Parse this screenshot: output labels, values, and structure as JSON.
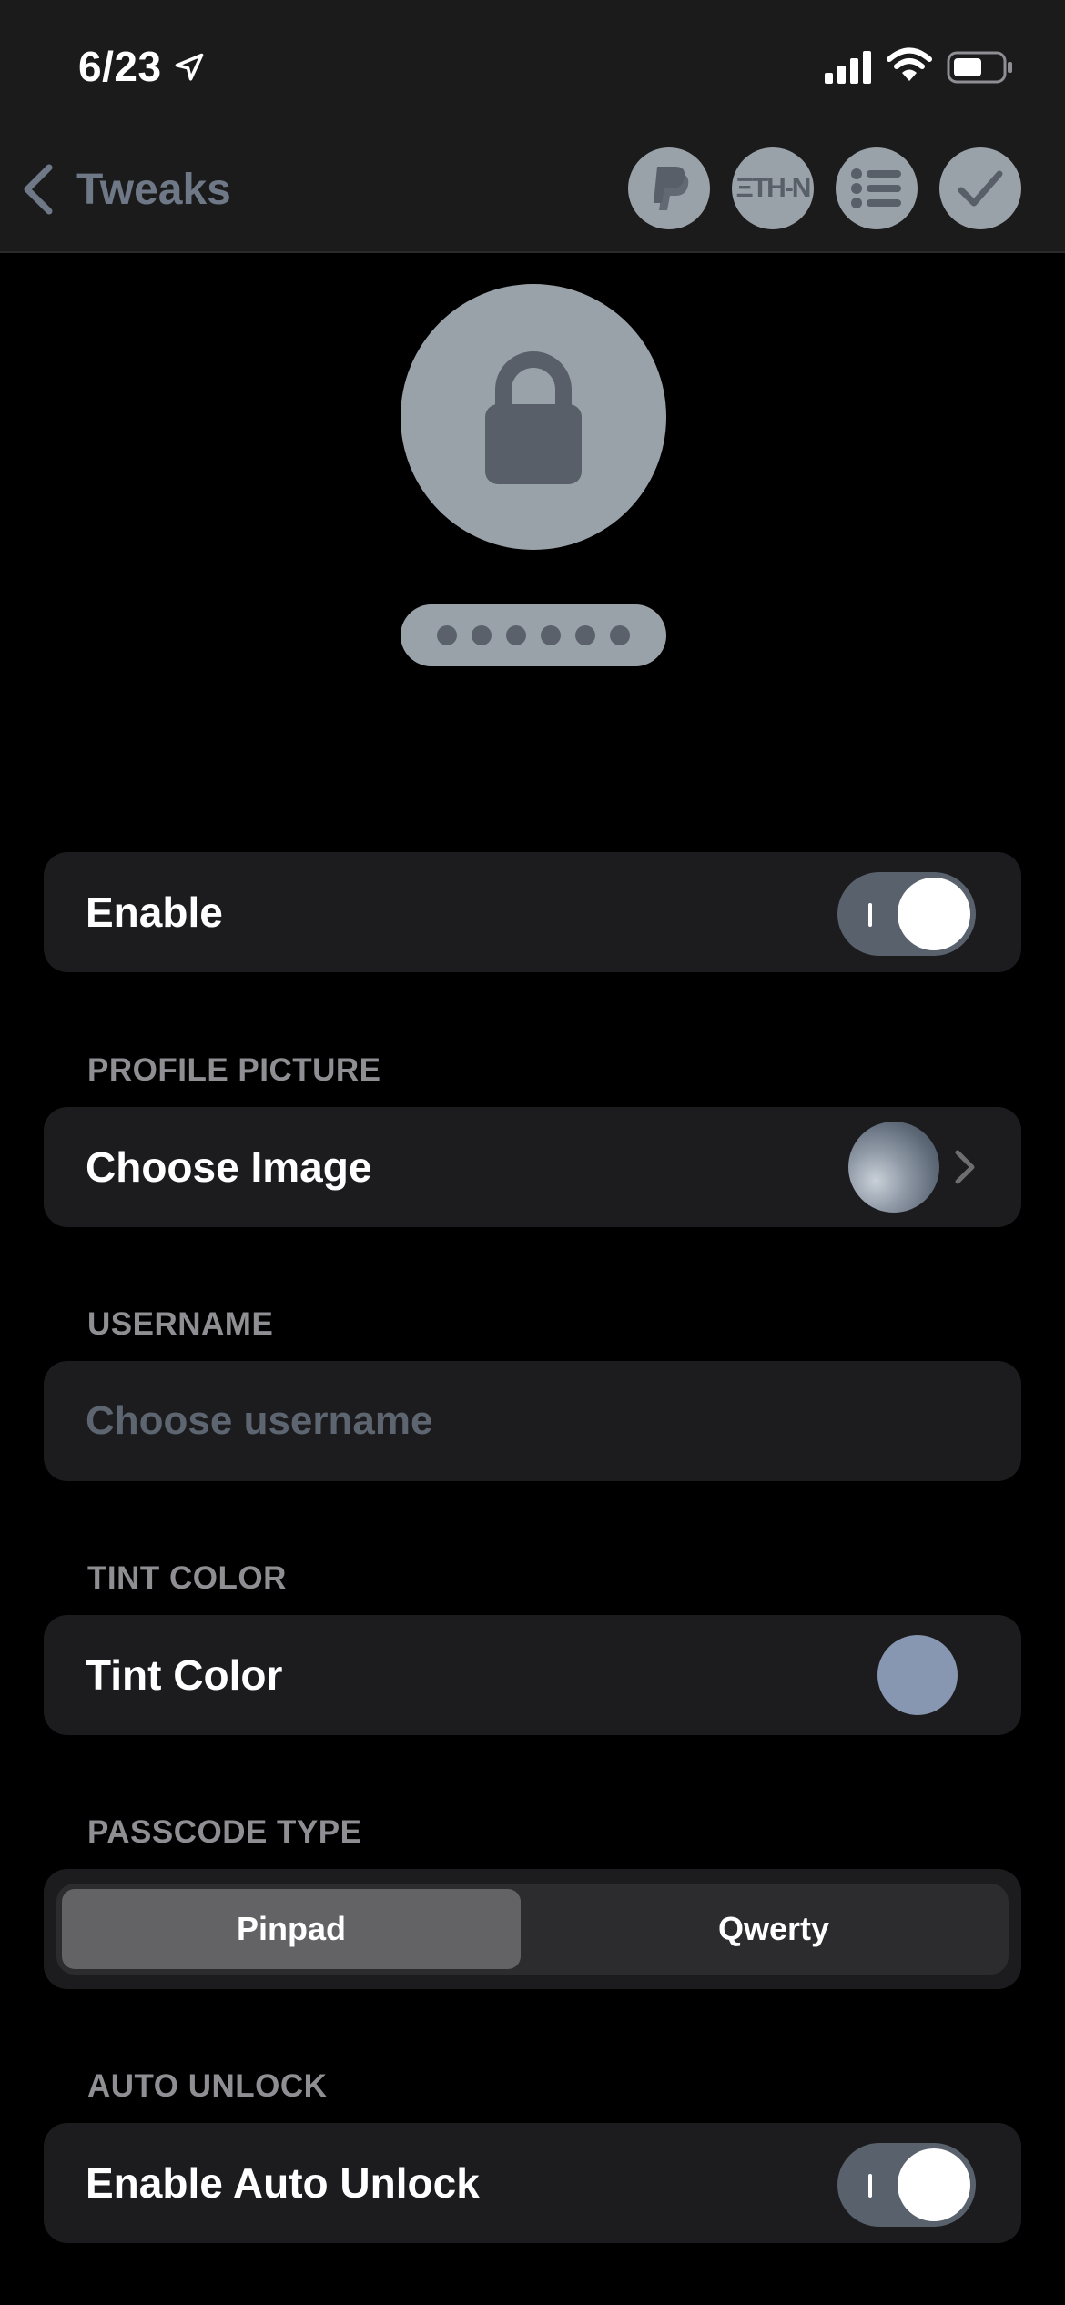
{
  "status_bar": {
    "time": "6/23",
    "icons": [
      "location-arrow-icon",
      "cellular-signal-icon",
      "wifi-icon",
      "battery-icon"
    ]
  },
  "nav": {
    "back_label": "Tweaks",
    "buttons": [
      {
        "name": "paypal-icon"
      },
      {
        "name": "eth-icon",
        "text": "ΞTH-N"
      },
      {
        "name": "list-icon"
      },
      {
        "name": "checkmark-icon"
      }
    ]
  },
  "preview": {
    "icon": "lock-icon",
    "passcode_dots": 6
  },
  "enable": {
    "label": "Enable",
    "on": true
  },
  "profile_picture": {
    "header": "PROFILE PICTURE",
    "label": "Choose Image"
  },
  "username": {
    "header": "USERNAME",
    "placeholder": "Choose username",
    "value": ""
  },
  "tint_color": {
    "header": "TINT COLOR",
    "label": "Tint Color",
    "color": "#8797b1"
  },
  "passcode_type": {
    "header": "PASSCODE TYPE",
    "options": [
      "Pinpad",
      "Qwerty"
    ],
    "selected": "Pinpad"
  },
  "auto_unlock": {
    "header": "AUTO UNLOCK",
    "label": "Enable Auto Unlock",
    "on": true
  },
  "colors": {
    "background": "#000000",
    "cell": "#1c1c1e",
    "accent_gray": "#9aa2a9",
    "toggle_on": "#59616d"
  }
}
